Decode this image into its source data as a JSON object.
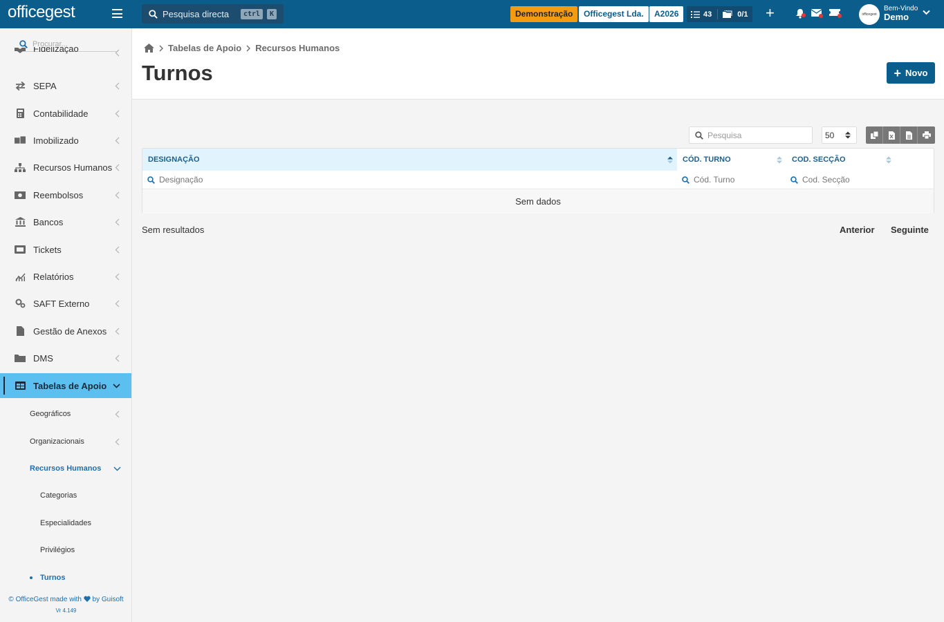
{
  "topbar": {
    "logo": "officegest",
    "search_label": "Pesquisa directa",
    "kbd_ctrl": "ctrl",
    "kbd_k": "K",
    "demo_badge": "Demonstração",
    "company": "Officegest Lda.",
    "year": "A2026",
    "tasks_count": "43",
    "folders_count": "0/1",
    "welcome_label": "Bem-Vindo",
    "user_name": "Demo",
    "avatar_text": "officegest"
  },
  "sidebar": {
    "search_placeholder": "Procurar...",
    "items": [
      {
        "label": "Fidelização",
        "icon": "handshake-icon"
      },
      {
        "label": "SEPA",
        "icon": "exchange-icon"
      },
      {
        "label": "Contabilidade",
        "icon": "calculator-icon"
      },
      {
        "label": "Imobilizado",
        "icon": "boxes-icon"
      },
      {
        "label": "Recursos Humanos",
        "icon": "sitemap-icon"
      },
      {
        "label": "Reembolsos",
        "icon": "money-icon"
      },
      {
        "label": "Bancos",
        "icon": "bank-icon"
      },
      {
        "label": "Tickets",
        "icon": "ticket-icon"
      },
      {
        "label": "Relatórios",
        "icon": "chart-icon"
      },
      {
        "label": "SAFT Externo",
        "icon": "gears-icon"
      },
      {
        "label": "Gestão de Anexos",
        "icon": "file-icon"
      },
      {
        "label": "DMS",
        "icon": "folder-icon"
      },
      {
        "label": "Tabelas de Apoio",
        "icon": "table-icon"
      }
    ],
    "sub_items": [
      {
        "label": "Geográficos"
      },
      {
        "label": "Organizacionais"
      },
      {
        "label": "Recursos Humanos"
      }
    ],
    "sub_sub_items": [
      {
        "label": "Categorias"
      },
      {
        "label": "Especialidades"
      },
      {
        "label": "Privilégios"
      },
      {
        "label": "Turnos"
      }
    ],
    "footer_left": "© OfficeGest made with",
    "footer_right": "by Guisoft",
    "version": "Vr 4.149"
  },
  "breadcrumb": [
    "Tabelas de Apoio",
    "Recursos Humanos"
  ],
  "page": {
    "title": "Turnos",
    "new_button": "Novo"
  },
  "toolbar": {
    "search_placeholder": "Pesquisa",
    "page_size": "50"
  },
  "grid": {
    "columns": [
      {
        "header": "DESIGNAÇÃO",
        "filter_placeholder": "Designação"
      },
      {
        "header": "CÓD. TURNO",
        "filter_placeholder": "Cód. Turno"
      },
      {
        "header": "COD. SECÇÃO",
        "filter_placeholder": "Cod. Secção"
      }
    ],
    "empty_text": "Sem dados"
  },
  "pagination": {
    "status": "Sem resultados",
    "prev": "Anterior",
    "next": "Seguinte"
  },
  "colors": {
    "primary": "#0b5d8c",
    "active_menu": "#5bc0f0",
    "demo_badge": "#f39c12",
    "link": "#1d6fad"
  }
}
